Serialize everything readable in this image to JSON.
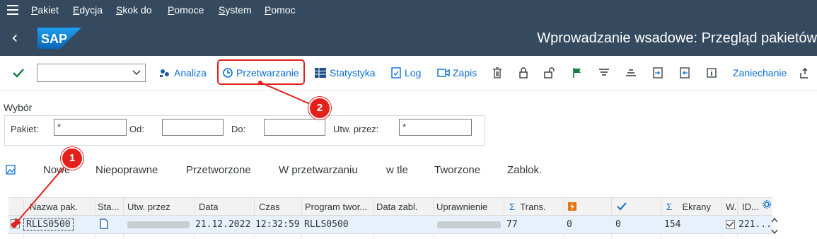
{
  "menubar": {
    "items": [
      "Pakiet",
      "Edycja",
      "Skok do",
      "Pomoce",
      "System",
      "Pomoc"
    ]
  },
  "titlebar": {
    "logo_text": "SAP",
    "title": "Wprowadzanie wsadowe: Przegląd pakietów"
  },
  "toolbar": {
    "analiza": "Analiza",
    "przetwarzanie": "Przetwarzanie",
    "statystyka": "Statystyka",
    "log": "Log",
    "zapis": "Zapis",
    "zaniechanie": "Zaniechanie",
    "command_value": ""
  },
  "selection": {
    "title": "Wybór",
    "pakiet_label": "Pakiet:",
    "pakiet_value": "*",
    "od_label": "Od:",
    "od_value": "",
    "do_label": "Do:",
    "do_value": "",
    "utw_label": "Utw. przez:",
    "utw_value": "*"
  },
  "tabs": [
    "Nowe",
    "Niepoprawne",
    "Przetworzone",
    "W przetwarzaniu",
    "w tle",
    "Tworzone",
    "Zablok."
  ],
  "table": {
    "headers": [
      "Nazwa pak.",
      "Sta...",
      "Utw. przez",
      "Data",
      "Czas",
      "Program twor...",
      "Data zabl.",
      "Uprawnienie",
      "Trans.",
      "",
      "",
      "Ekrany",
      "W.",
      "ID..."
    ],
    "row": {
      "nazwa": "RLLS0500",
      "data": "21.12.2022",
      "czas": "12:32:59",
      "program": "RLLS0500",
      "trans": "77",
      "col_err": "0",
      "col_ok": "0",
      "ekrany": "154",
      "id": "221..."
    }
  },
  "annotations": {
    "badge1": "1",
    "badge2": "2"
  },
  "colors": {
    "shell": "#354a5f",
    "link": "#0a6ed1",
    "annotation": "#e3201b",
    "row_selected": "#e8f1fb"
  }
}
